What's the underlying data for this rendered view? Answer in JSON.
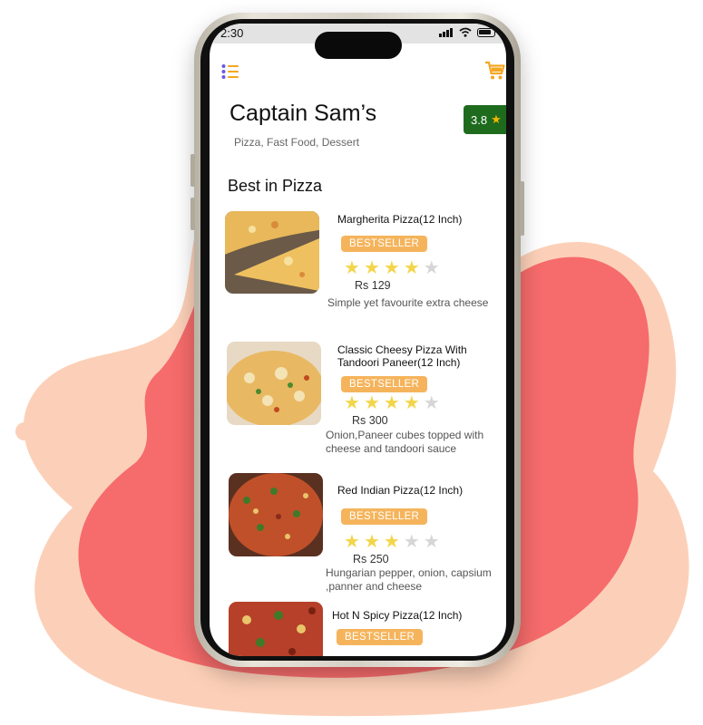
{
  "status_bar": {
    "time": "2:30"
  },
  "icons": {
    "menu": "menu-list-icon",
    "cart": "cart-icon",
    "star": "star-icon"
  },
  "colors": {
    "blob_red": "#f66b6b",
    "blob_peach": "#fcd0b8",
    "accent_orange": "#f5a623",
    "rating_green": "#1e6b1e",
    "badge_orange": "#f5b45c",
    "star_yellow": "#f3d54a"
  },
  "restaurant": {
    "name": "Captain Sam’s",
    "cuisines": "Pizza, Fast Food, Dessert",
    "rating": "3.8"
  },
  "section": {
    "title": "Best in Pizza"
  },
  "items": [
    {
      "name": "Margherita Pizza(12 Inch)",
      "badge": "BESTSELLER",
      "rating": 4,
      "price": "Rs 129",
      "description": "Simple yet favourite extra cheese"
    },
    {
      "name": "Classic Cheesy Pizza With Tandoori Paneer(12 Inch)",
      "badge": "BESTSELLER",
      "rating": 4,
      "price": "Rs 300",
      "description": "Onion,Paneer cubes topped with cheese and tandoori sauce"
    },
    {
      "name": "Red Indian Pizza(12 Inch)",
      "badge": "BESTSELLER",
      "rating": 3,
      "price": "Rs 250",
      "description": "Hungarian pepper, onion, capsium ,panner and cheese"
    },
    {
      "name": "Hot N Spicy Pizza(12 Inch)",
      "badge": "BESTSELLER"
    }
  ]
}
